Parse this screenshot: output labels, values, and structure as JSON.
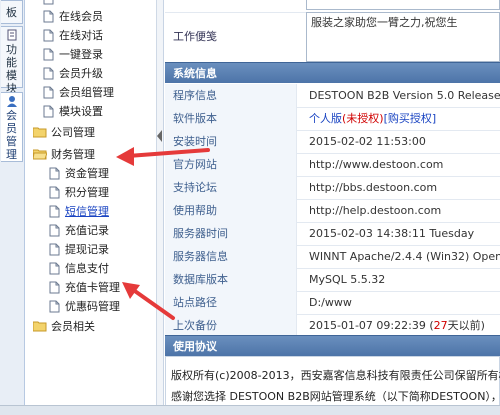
{
  "vtabs": [
    {
      "label": "板",
      "active": false
    },
    {
      "label": "功能模块",
      "active": false
    },
    {
      "label": "会员管理",
      "active": true
    }
  ],
  "tree": {
    "member_items": [
      "在线会员",
      "在线对话",
      "一键登录",
      "会员升级",
      "会员组管理",
      "模块设置"
    ],
    "company_group": "公司管理",
    "finance_group": "财务管理",
    "finance_items": [
      "资金管理",
      "积分管理",
      "短信管理",
      "充值记录",
      "提现记录",
      "信息支付",
      "充值卡管理",
      "优惠码管理"
    ],
    "member_related_group": "会员相关"
  },
  "top_form": {
    "work_note_label": "工作便笺",
    "work_note_value": "服装之家助您一臂之力,祝您生"
  },
  "sysinfo": {
    "title": "系统信息",
    "rows": [
      {
        "k": "程序信息",
        "v": "DESTOON B2B Version 5.0 Release 2"
      },
      {
        "k": "软件版本",
        "v_link": "个人版",
        "v_red": "(未授权)",
        "v_link2": "[购买授权]"
      },
      {
        "k": "安装时间",
        "v": "2015-02-02 11:53:00"
      },
      {
        "k": "官方网站",
        "v": "http://www.destoon.com"
      },
      {
        "k": "支持论坛",
        "v": "http://bbs.destoon.com"
      },
      {
        "k": "使用帮助",
        "v": "http://help.destoon.com"
      },
      {
        "k": "服务器时间",
        "v": "2015-02-03 14:38:11 Tuesday"
      },
      {
        "k": "服务器信息",
        "v": "WINNT Apache/2.4.4 (Win32) OpenS"
      },
      {
        "k": "数据库版本",
        "v": "MySQL 5.5.32"
      },
      {
        "k": "站点路径",
        "v": "D:/www"
      },
      {
        "k": "上次备份",
        "v_pre": "2015-01-07 09:22:39 (",
        "v_red": "27",
        "v_post": "天以前)"
      }
    ]
  },
  "license": {
    "title": "使用协议",
    "line1": "版权所有(c)2008-2013，西安嘉客信息科技有限责任公司保留所有权利",
    "line2": "感谢您选择 DESTOON B2B网站管理系统（以下简称DESTOON），"
  },
  "colors": {
    "accent_blue": "#4d74a8",
    "link": "#1a44c2",
    "annotation_red": "#e53a3a"
  }
}
